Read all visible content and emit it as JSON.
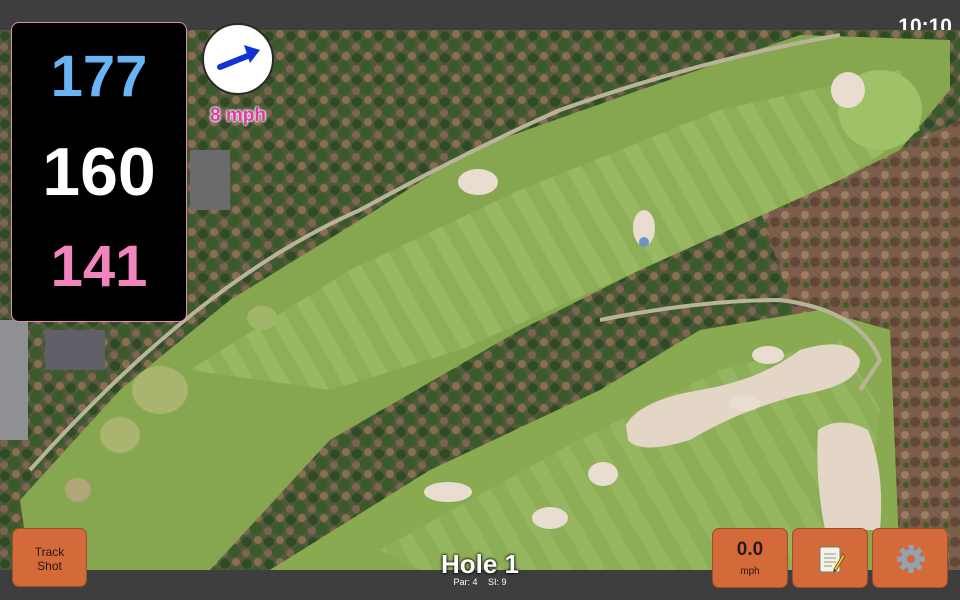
{
  "status": {
    "time": "10:10"
  },
  "distances": {
    "back": "177",
    "middle": "160",
    "front": "141"
  },
  "wind": {
    "speed": "8 mph",
    "direction_icon": "arrow-east-northeast"
  },
  "hole": {
    "title": "Hole 1",
    "par": "Par: 4",
    "stroke_index": "SI: 9"
  },
  "buttons": {
    "track_shot_line1": "Track",
    "track_shot_line2": "Shot",
    "speed_value": "0.0",
    "speed_unit": "mph",
    "notes_icon": "notepad-icon",
    "settings_icon": "gear-icon"
  },
  "colors": {
    "back": "#6ab3f5",
    "middle": "#ffffff",
    "front": "#f285bd",
    "button": "#d4693a",
    "wind_text": "#e13aa0"
  }
}
